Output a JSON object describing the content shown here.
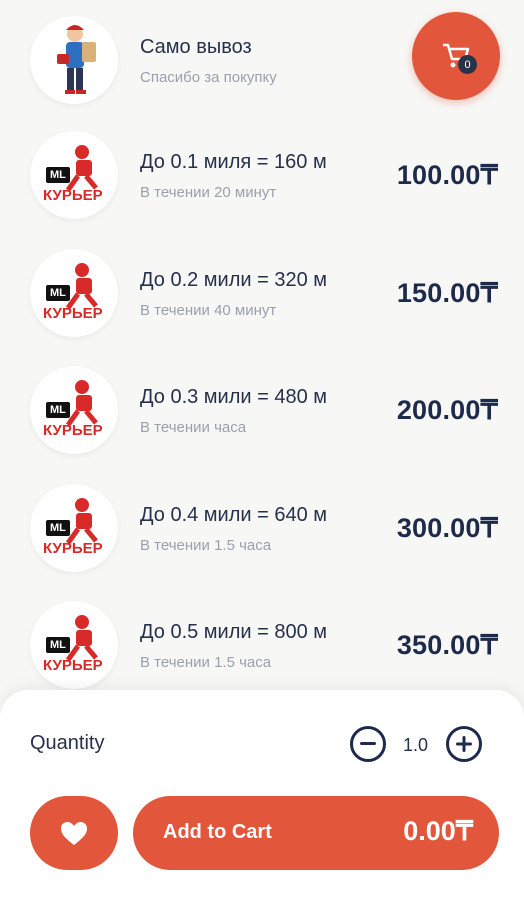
{
  "header_item": {
    "title": "Само вывоз",
    "subtitle": "Спасибо за покупку",
    "avatar_icon": "delivery-man-illustration"
  },
  "cart": {
    "icon": "cart-icon",
    "count": "0"
  },
  "courier_logo": {
    "ml": "ML",
    "text": "КУРЬЕР"
  },
  "options": [
    {
      "title": "До 0.1 миля = 160 м",
      "subtitle": "В течении 20 минут",
      "price": "100.00₸"
    },
    {
      "title": "До 0.2 мили = 320 м",
      "subtitle": "В течении 40 минут",
      "price": "150.00₸"
    },
    {
      "title": "До 0.3 мили = 480 м",
      "subtitle": "В течении часа",
      "price": "200.00₸"
    },
    {
      "title": "До 0.4 мили = 640 м",
      "subtitle": "В течении 1.5 часа",
      "price": "300.00₸"
    },
    {
      "title": "До 0.5 мили = 800 м",
      "subtitle": "В течении 1.5 часа",
      "price": "350.00₸"
    }
  ],
  "bottom_panel": {
    "quantity_label": "Quantity",
    "quantity_value": "1.0",
    "add_to_cart_label": "Add to Cart",
    "total": "0.00₸"
  },
  "colors": {
    "accent": "#e2563b",
    "text_dark": "#1d2a4a",
    "text_muted": "#9aa0ac"
  }
}
